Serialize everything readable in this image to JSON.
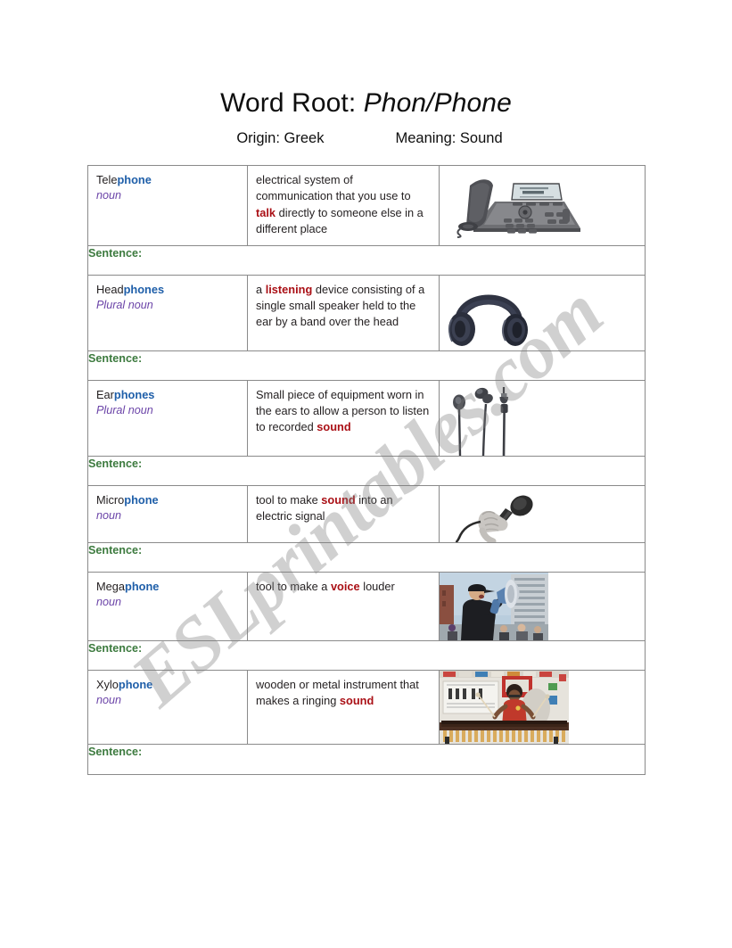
{
  "document": {
    "title_prefix": "Word Root: ",
    "title_root": "Phon/Phone",
    "origin": "Origin: Greek",
    "meaning": "Meaning: Sound",
    "watermark": "ESLprintables.com",
    "sentence_label": "Sentence:"
  },
  "colors": {
    "root_highlight": "#1f5fa9",
    "part_of_speech": "#6b44a8",
    "keyword": "#aa1016",
    "sentence_label": "#3c7a3e",
    "border": "#8a8a8a",
    "text": "#231f20"
  },
  "table": {
    "rows": [
      {
        "word_prefix": "Tele",
        "word_root": "phone",
        "part_of_speech": "noun",
        "definition_parts": [
          {
            "text": "electrical system of communication that you use to ",
            "highlight": false
          },
          {
            "text": "talk",
            "highlight": true
          },
          {
            "text": " directly to someone else in a different place",
            "highlight": false
          }
        ],
        "image_name": "desk-telephone-photo",
        "image_alt": "Gray desk telephone with handset, LCD screen and keypad"
      },
      {
        "word_prefix": "Head",
        "word_root": "phones",
        "part_of_speech": "Plural noun",
        "definition_parts": [
          {
            "text": "a ",
            "highlight": false
          },
          {
            "text": "listening",
            "highlight": true
          },
          {
            "text": " device consisting of a single small speaker held to the ear by a band over the head",
            "highlight": false
          }
        ],
        "image_name": "over-ear-headphones-photo",
        "image_alt": "Dark navy over-ear headphones"
      },
      {
        "word_prefix": "Ear",
        "word_root": "phones",
        "part_of_speech": "Plural noun",
        "definition_parts": [
          {
            "text": "Small piece of equipment worn in the ears to allow a person to listen to recorded ",
            "highlight": false
          },
          {
            "text": "sound",
            "highlight": true
          }
        ],
        "image_name": "earbuds-photo",
        "image_alt": "Pair of black earbuds with cables and 3.5 mm plug"
      },
      {
        "word_prefix": "Micro",
        "word_root": "phone",
        "part_of_speech": "noun",
        "definition_parts": [
          {
            "text": "tool to make ",
            "highlight": false
          },
          {
            "text": "sound",
            "highlight": true
          },
          {
            "text": " into an electric signal",
            "highlight": false
          }
        ],
        "image_name": "hand-holding-microphone-photo",
        "image_alt": "Hand holding a corded microphone"
      },
      {
        "word_prefix": "Mega",
        "word_root": "phone",
        "part_of_speech": "noun",
        "definition_parts": [
          {
            "text": "tool to make a ",
            "highlight": false
          },
          {
            "text": "voice",
            "highlight": true
          },
          {
            "text": " louder",
            "highlight": false
          }
        ],
        "image_name": "man-with-megaphone-photo",
        "image_alt": "Man in dark coat and cap shouting into a megaphone outdoors"
      },
      {
        "word_prefix": "Xylo",
        "word_root": "phone",
        "part_of_speech": "noun",
        "definition_parts": [
          {
            "text": "wooden or metal instrument that makes a ringing ",
            "highlight": false
          },
          {
            "text": "sound",
            "highlight": true
          }
        ],
        "image_name": "student-playing-xylophone-photo",
        "image_alt": "Student in red shirt playing a marimba in a classroom"
      }
    ]
  }
}
